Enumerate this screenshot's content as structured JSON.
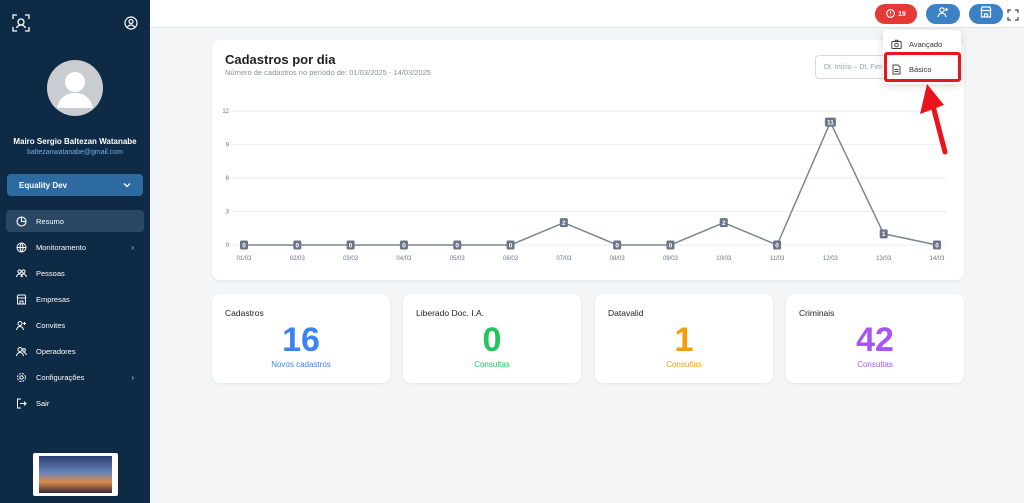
{
  "colors": {
    "sidebar": "#0f2a44",
    "accent": "#3b82c4",
    "danger": "#e53935",
    "blue": "#3b82f6",
    "green": "#22c55e",
    "orange": "#f59e0b",
    "purple": "#a855f7"
  },
  "sidebar": {
    "user_name": "Mairo Sergio Baltezan Watanabe",
    "user_email": "baltezanwatanabe@gmail.com",
    "org": "Equality Dev",
    "items": [
      {
        "label": "Resumo",
        "icon": "pie-chart-icon"
      },
      {
        "label": "Monitoramento",
        "icon": "globe-icon"
      },
      {
        "label": "Pessoas",
        "icon": "people-icon"
      },
      {
        "label": "Empresas",
        "icon": "store-icon"
      },
      {
        "label": "Convites",
        "icon": "user-plus-icon"
      },
      {
        "label": "Operadores",
        "icon": "operators-icon"
      },
      {
        "label": "Configurações",
        "icon": "gear-icon"
      },
      {
        "label": "Sair",
        "icon": "logout-icon"
      }
    ]
  },
  "topbar": {
    "alert_count": "19"
  },
  "dropdown": {
    "items": [
      {
        "label": "Avançado",
        "icon": "camera-icon"
      },
      {
        "label": "Básico",
        "icon": "document-icon"
      }
    ]
  },
  "chart": {
    "title": "Cadastros por dia",
    "subtitle": "Número de cadastros no período de: 01/03/2025 - 14/03/2025",
    "date_placeholder": "Dt. Início – Dt. Fim"
  },
  "chart_data": {
    "type": "line",
    "categories": [
      "01/03",
      "02/03",
      "03/03",
      "04/03",
      "05/03",
      "06/03",
      "07/03",
      "08/03",
      "09/03",
      "10/03",
      "11/03",
      "12/03",
      "13/03",
      "14/03"
    ],
    "values": [
      0,
      0,
      0,
      0,
      0,
      0,
      2,
      0,
      0,
      2,
      0,
      11,
      1,
      0
    ],
    "yticks": [
      "0",
      "3",
      "6",
      "9",
      "12"
    ],
    "ylim": [
      0,
      12
    ],
    "grid": true
  },
  "stats": [
    {
      "title": "Cadastros",
      "value": "16",
      "sub": "Novos cadastros",
      "color": "#3b82f6"
    },
    {
      "title": "Liberado Doc. I.A.",
      "value": "0",
      "sub": "Consultas",
      "color": "#22c55e"
    },
    {
      "title": "Datavalid",
      "value": "1",
      "sub": "Consultas",
      "color": "#f59e0b"
    },
    {
      "title": "Criminais",
      "value": "42",
      "sub": "Consultas",
      "color": "#a855f7"
    }
  ]
}
